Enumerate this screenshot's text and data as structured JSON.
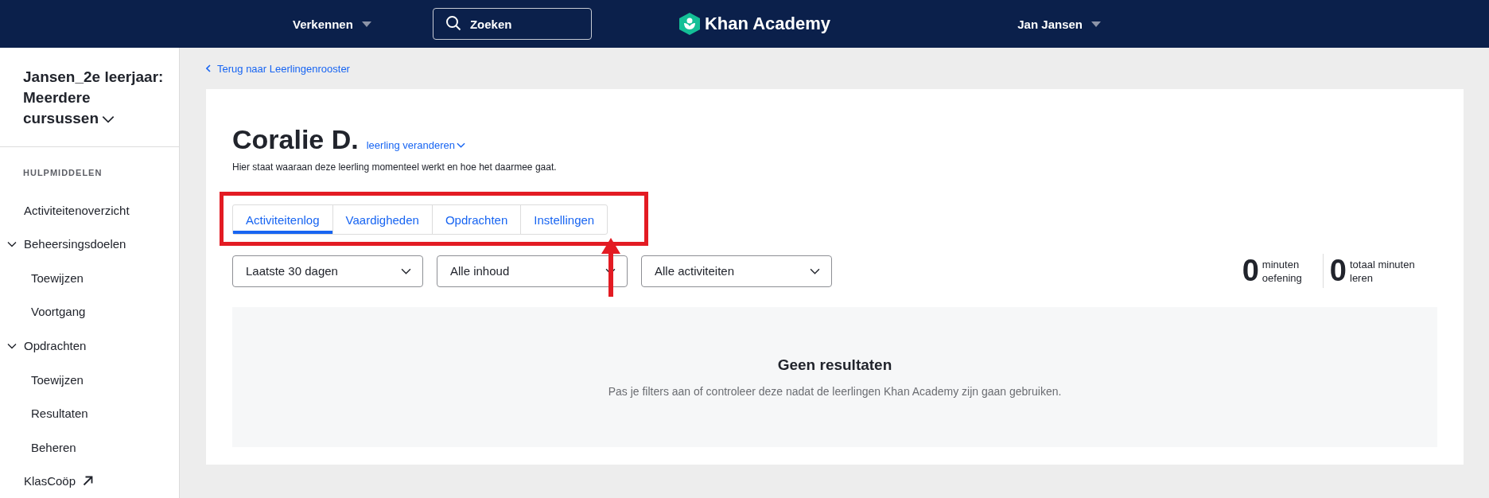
{
  "header": {
    "explore": "Verkennen",
    "search": {
      "placeholder": "Zoeken"
    },
    "logo": "Khan Academy",
    "user": "Jan Jansen"
  },
  "sidebar": {
    "class_name": "Jansen_2e leerjaar: Meerdere cursussen",
    "section_label": "HULPMIDDELEN",
    "items": [
      {
        "label": "Activiteitenoverzicht",
        "kind": "link"
      },
      {
        "label": "Beheersingsdoelen",
        "kind": "group",
        "expanded": true,
        "children": [
          {
            "label": "Toewijzen"
          },
          {
            "label": "Voortgang"
          }
        ]
      },
      {
        "label": "Opdrachten",
        "kind": "group",
        "expanded": true,
        "children": [
          {
            "label": "Toewijzen"
          },
          {
            "label": "Resultaten"
          },
          {
            "label": "Beheren"
          }
        ]
      },
      {
        "label": "KlasCoöp",
        "kind": "external"
      }
    ]
  },
  "back_link": "Terug naar Leerlingenrooster",
  "student": {
    "name": "Coralie D.",
    "change_link": "leerling veranderen",
    "description": "Hier staat waaraan deze leerling momenteel werkt en hoe het daarmee gaat."
  },
  "tabs": [
    {
      "label": "Activiteitenlog",
      "selected": true
    },
    {
      "label": "Vaardigheden",
      "selected": false
    },
    {
      "label": "Opdrachten",
      "selected": false
    },
    {
      "label": "Instellingen",
      "selected": false
    }
  ],
  "filters": [
    {
      "value": "Laatste 30 dagen"
    },
    {
      "value": "Alle inhoud"
    },
    {
      "value": "Alle activiteiten"
    }
  ],
  "stats": [
    {
      "value": "0",
      "label": "minuten oefening"
    },
    {
      "value": "0",
      "label": "totaal minuten leren"
    }
  ],
  "empty_state": {
    "title": "Geen resultaten",
    "message": "Pas je filters aan of controleer deze nadat de leerlingen Khan Academy zijn gaan gebruiken."
  }
}
